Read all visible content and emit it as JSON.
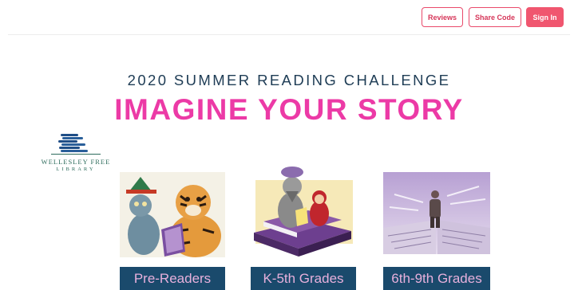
{
  "header": {
    "reviews_label": "Reviews",
    "share_label": "Share Code",
    "signin_label": "Sign In"
  },
  "hero": {
    "subtitle": "2020 SUMMER READING CHALLENGE",
    "headline": "IMAGINE YOUR STORY"
  },
  "logo": {
    "line1": "WELLESLEY FREE",
    "line2": "LIBRARY"
  },
  "groups": [
    {
      "label": "Pre-Readers",
      "icon": "tiger-and-cat-reading-illustration"
    },
    {
      "label": "K-5th Grades",
      "icon": "wolf-and-red-riding-hood-illustration"
    },
    {
      "label": "6th-9th Grades",
      "icon": "traveler-on-open-book-illustration"
    }
  ],
  "colors": {
    "accent": "#f0566f",
    "headline": "#ec3aa6",
    "subtitle": "#1e3c55",
    "label_bg": "#1a4a6c",
    "label_text": "#e7b0dc"
  }
}
